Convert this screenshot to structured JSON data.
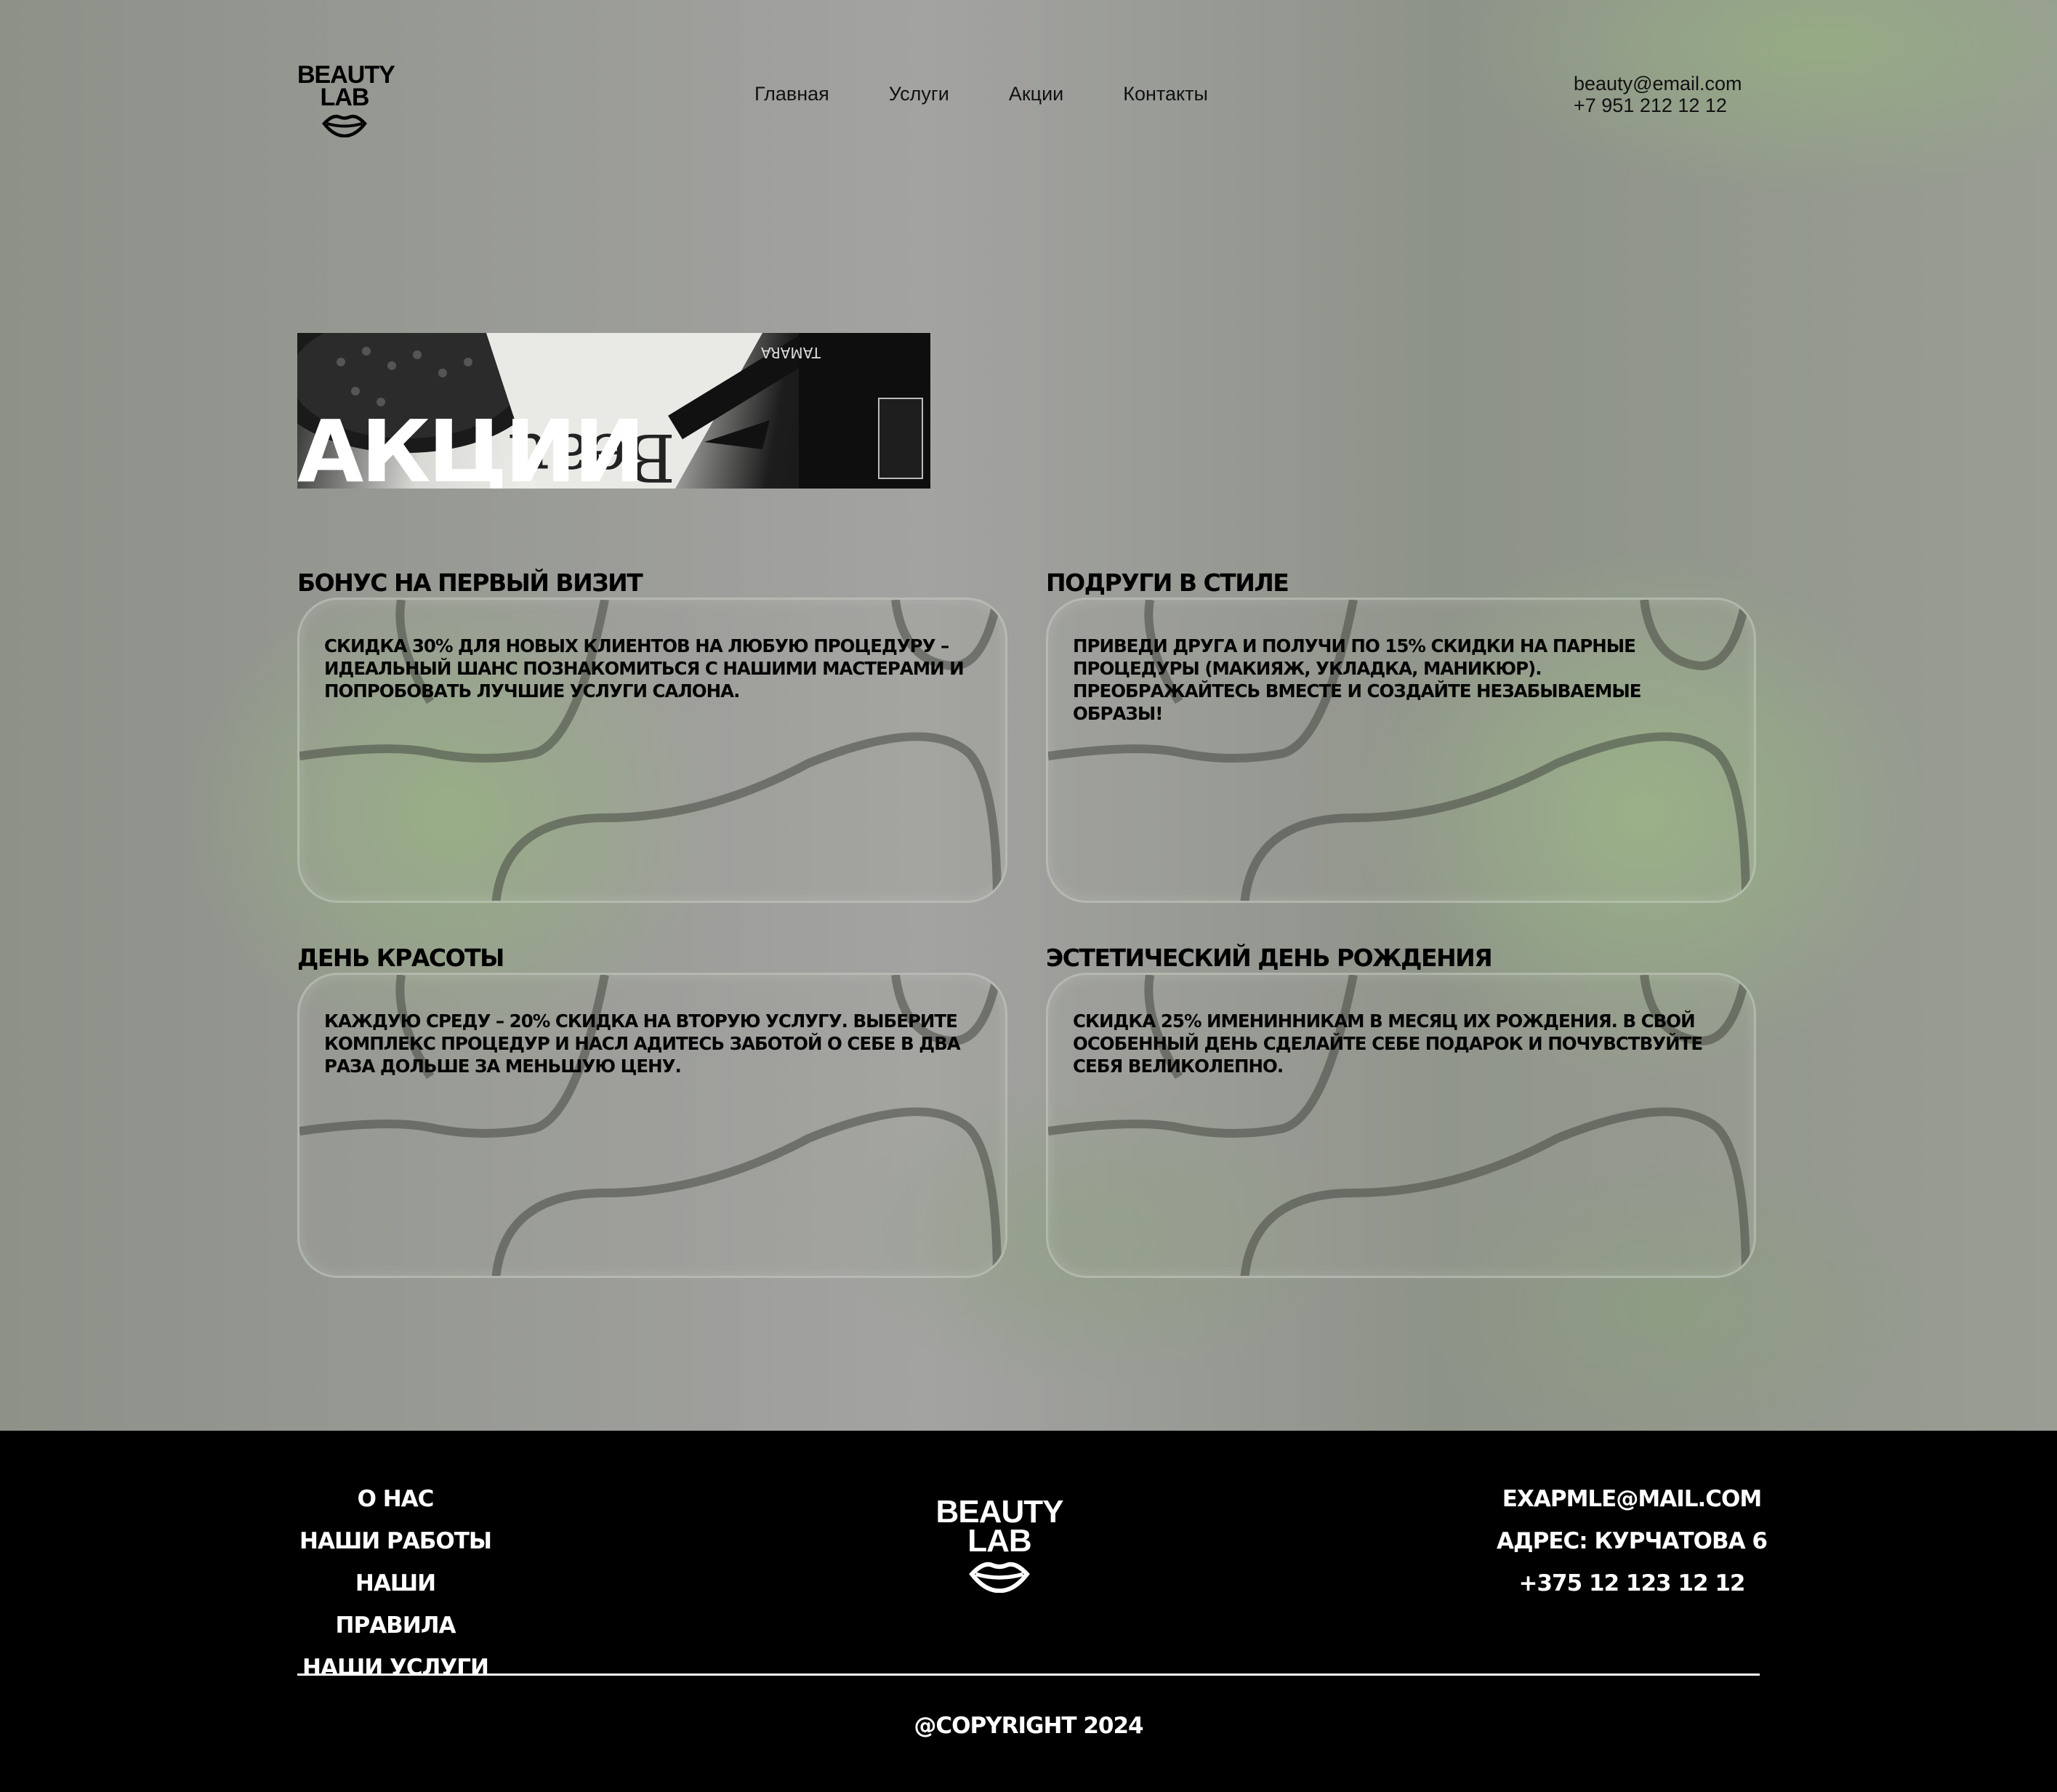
{
  "header": {
    "logo_line1": "BEAUTY",
    "logo_line2": "LAB",
    "nav": [
      "Главная",
      "Услуги",
      "Акции",
      "Контакты"
    ],
    "email": "beauty@email.com",
    "phone": "+7 951 212 12 12"
  },
  "hero": {
    "title": "АКЦИИ"
  },
  "promos": [
    {
      "title": "БОНУС НА ПЕРВЫЙ ВИЗИТ",
      "text": "Скидка 30% для новых клиентов на любую процедуру – идеальный шанс познакомиться с нашими мастерами и попробовать лучшие услуги салона."
    },
    {
      "title": "ПОДРУГИ В СТИЛЕ",
      "text": "Приведи друга и получи по 15% скидки на парные процедуры (макияж, укладка, маникюр). Преображайтесь вместе и создайте незабываемые образы!"
    },
    {
      "title": "ДЕНЬ КРАСОТЫ",
      "text": "Каждую среду – 20% скидка на вторую услугу. Выберите комплекс процедур и насл адитесь заботой о себе в два раза дольше за меньшую цену."
    },
    {
      "title": "ЭСТЕТИЧЕСКИЙ ДЕНЬ РОЖДЕНИЯ",
      "text": "Скидка 25% именинникам в месяц их рождения. В свой особенный день сделайте себе подарок и почувствуйте себя великолепно."
    }
  ],
  "footer": {
    "links": [
      "О НАС",
      "НАШИ РАБОТЫ",
      "НАШИ ПРАВИЛА",
      "НАШИ УСЛУГИ"
    ],
    "logo_line1": "BEAUTY",
    "logo_line2": "LAB",
    "email": "EXAPMLE@MAIL.COM",
    "address": "АДРЕС: КУРЧАТОВА 6",
    "phone": "+375 12 123 12 12",
    "copyright": "@COPYRIGHT 2024"
  },
  "colors": {
    "background_green": "#98b082",
    "background_gray": "#a3a3a1",
    "footer": "#000000",
    "text": "#000000"
  }
}
